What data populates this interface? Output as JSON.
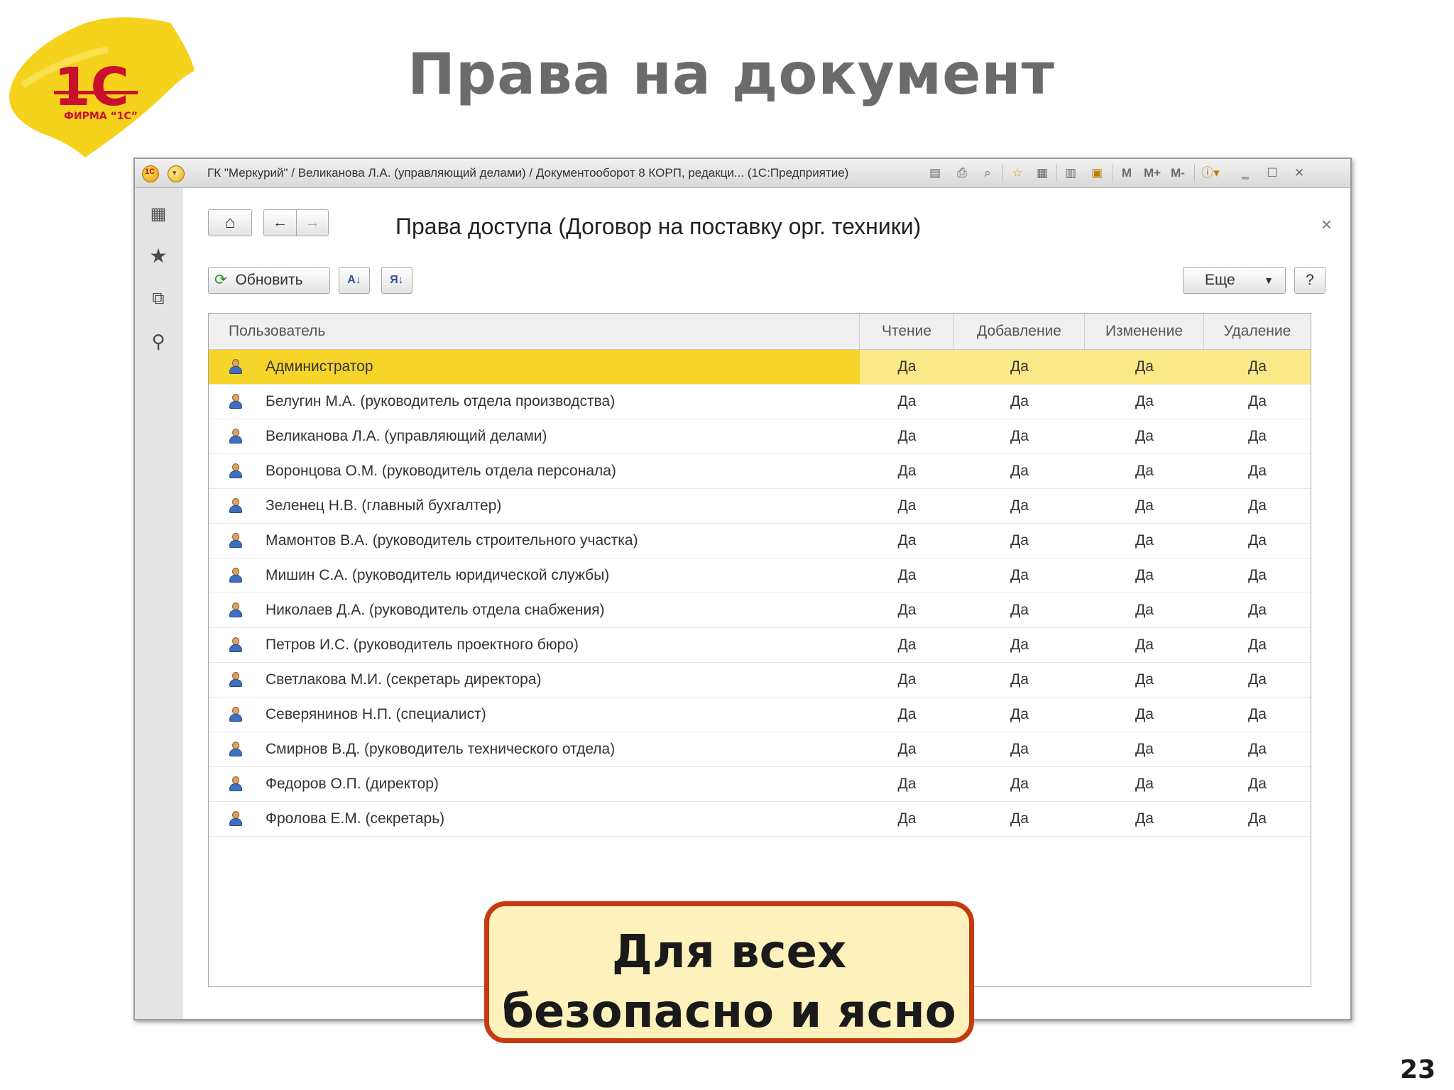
{
  "slide": {
    "title": "Права на документ",
    "page_number": "23",
    "logo": {
      "brand": "1С",
      "caption": "ФИРМА “1С”",
      "color": "#f5d21b",
      "text_color": "#c8102e"
    }
  },
  "window": {
    "title": "ГК \"Меркурий\" / Великанова Л.А. (управляющий делами) / Документооборот 8 КОРП, редакци... (1С:Предприятие)",
    "toolbar_icons": [
      "save-icon",
      "print-icon",
      "preview-icon",
      "favorites-icon",
      "history-icon",
      "calculator-icon",
      "calendar-icon",
      "memory-icon",
      "memory-plus-icon",
      "memory-minus-icon",
      "info-icon",
      "minimize-icon",
      "maximize-icon",
      "close-icon"
    ],
    "memory_labels": {
      "m": "M",
      "m_plus": "M+",
      "m_minus": "M-"
    }
  },
  "sidebar": {
    "items": [
      "apps-grid-icon",
      "star-icon",
      "history-icon",
      "search-icon"
    ]
  },
  "form": {
    "title": "Права доступа (Договор на поставку орг. техники)",
    "close_label": "×",
    "refresh_label": "Обновить",
    "more_label": "Еще",
    "help_label": "?"
  },
  "table": {
    "columns": [
      "Пользователь",
      "Чтение",
      "Добавление",
      "Изменение",
      "Удаление"
    ],
    "rows": [
      {
        "user": "Администратор",
        "read": "Да",
        "add": "Да",
        "edit": "Да",
        "delete": "Да"
      },
      {
        "user": "Белугин М.А. (руководитель отдела производства)",
        "read": "Да",
        "add": "Да",
        "edit": "Да",
        "delete": "Да"
      },
      {
        "user": "Великанова Л.А. (управляющий делами)",
        "read": "Да",
        "add": "Да",
        "edit": "Да",
        "delete": "Да"
      },
      {
        "user": "Воронцова О.М. (руководитель отдела персонала)",
        "read": "Да",
        "add": "Да",
        "edit": "Да",
        "delete": "Да"
      },
      {
        "user": "Зеленец Н.В. (главный бухгалтер)",
        "read": "Да",
        "add": "Да",
        "edit": "Да",
        "delete": "Да"
      },
      {
        "user": "Мамонтов В.А. (руководитель строительного участка)",
        "read": "Да",
        "add": "Да",
        "edit": "Да",
        "delete": "Да"
      },
      {
        "user": "Мишин С.А. (руководитель юридической службы)",
        "read": "Да",
        "add": "Да",
        "edit": "Да",
        "delete": "Да"
      },
      {
        "user": "Николаев Д.А. (руководитель отдела снабжения)",
        "read": "Да",
        "add": "Да",
        "edit": "Да",
        "delete": "Да"
      },
      {
        "user": "Петров И.С. (руководитель проектного бюро)",
        "read": "Да",
        "add": "Да",
        "edit": "Да",
        "delete": "Да"
      },
      {
        "user": "Светлакова М.И. (секретарь директора)",
        "read": "Да",
        "add": "Да",
        "edit": "Да",
        "delete": "Да"
      },
      {
        "user": "Северянинов Н.П. (специалист)",
        "read": "Да",
        "add": "Да",
        "edit": "Да",
        "delete": "Да"
      },
      {
        "user": "Смирнов В.Д. (руководитель технического отдела)",
        "read": "Да",
        "add": "Да",
        "edit": "Да",
        "delete": "Да"
      },
      {
        "user": "Федоров О.П. (директор)",
        "read": "Да",
        "add": "Да",
        "edit": "Да",
        "delete": "Да"
      },
      {
        "user": "Фролова Е.М. (секретарь)",
        "read": "Да",
        "add": "Да",
        "edit": "Да",
        "delete": "Да"
      }
    ],
    "selected_index": 0
  },
  "callout": {
    "line1": "Для всех",
    "line2": "безопасно и ясно"
  },
  "colors": {
    "selection": "#f6d42a",
    "selection_row": "#fbe887",
    "callout_border": "#c63a10",
    "callout_fill": "#fff1bc"
  }
}
